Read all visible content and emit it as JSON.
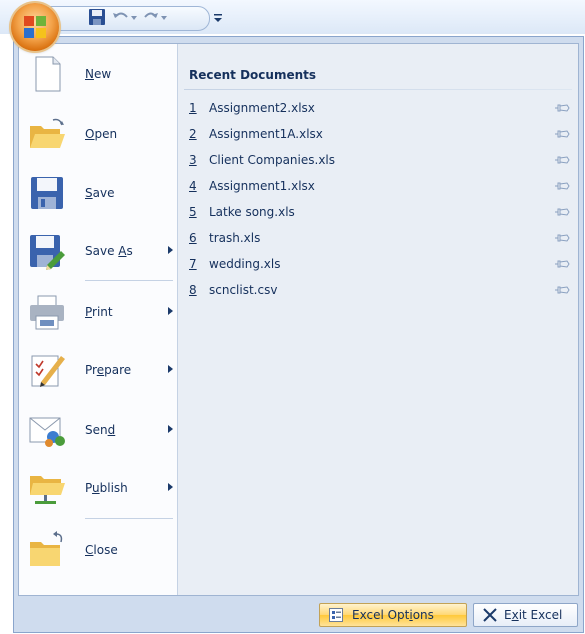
{
  "quick_access": {
    "buttons": [
      {
        "name": "save-icon"
      },
      {
        "name": "undo-icon"
      },
      {
        "name": "redo-icon"
      },
      {
        "name": "customize-icon"
      }
    ]
  },
  "commands": [
    {
      "id": "new",
      "label_pre": "",
      "accel": "N",
      "label_post": "ew",
      "icon": "new-document-icon",
      "submenu": false
    },
    {
      "id": "open",
      "label_pre": "",
      "accel": "O",
      "label_post": "pen",
      "icon": "open-folder-icon",
      "submenu": false
    },
    {
      "id": "save",
      "label_pre": "",
      "accel": "S",
      "label_post": "ave",
      "icon": "save-disk-icon",
      "submenu": false
    },
    {
      "id": "save-as",
      "label_pre": "Save ",
      "accel": "A",
      "label_post": "s",
      "icon": "save-as-icon",
      "submenu": true
    },
    {
      "id": "print",
      "label_pre": "",
      "accel": "P",
      "label_post": "rint",
      "icon": "printer-icon",
      "submenu": true
    },
    {
      "id": "prepare",
      "label_pre": "Pr",
      "accel": "e",
      "label_post": "pare",
      "icon": "prepare-icon",
      "submenu": true
    },
    {
      "id": "send",
      "label_pre": "Sen",
      "accel": "d",
      "label_post": "",
      "icon": "send-icon",
      "submenu": true
    },
    {
      "id": "publish",
      "label_pre": "P",
      "accel": "u",
      "label_post": "blish",
      "icon": "publish-icon",
      "submenu": true
    },
    {
      "id": "close",
      "label_pre": "",
      "accel": "C",
      "label_post": "lose",
      "icon": "close-folder-icon",
      "submenu": false
    }
  ],
  "recent": {
    "title": "Recent Documents",
    "items": [
      {
        "num": "1",
        "name": "Assignment2.xlsx"
      },
      {
        "num": "2",
        "name": "Assignment1A.xlsx"
      },
      {
        "num": "3",
        "name": "Client Companies.xls"
      },
      {
        "num": "4",
        "name": "Assignment1.xlsx"
      },
      {
        "num": "5",
        "name": "Latke song.xls"
      },
      {
        "num": "6",
        "name": "trash.xls"
      },
      {
        "num": "7",
        "name": "wedding.xls"
      },
      {
        "num": "8",
        "name": "scnclist.csv"
      }
    ]
  },
  "footer": {
    "options": {
      "pre": "Excel Opt",
      "accel": "i",
      "post": "ons"
    },
    "exit": {
      "pre": "E",
      "accel": "x",
      "post": "it Excel"
    }
  },
  "colors": {
    "menu_text": "#15305c",
    "accent_orange": "#f3a34a",
    "frame_blue": "#cfdcee"
  }
}
